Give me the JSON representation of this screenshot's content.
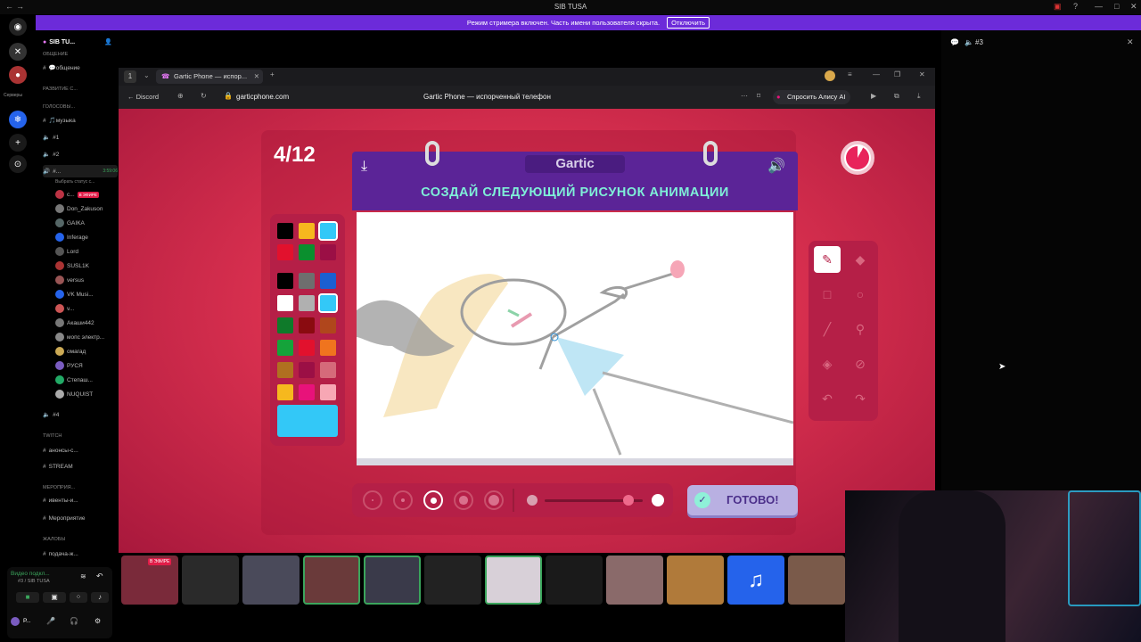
{
  "window": {
    "title": "SIB TUSA"
  },
  "banner": {
    "text": "Режим стримера включен. Часть имени пользователя скрыта.",
    "button": "Отключить"
  },
  "rail": {
    "servers_label": "Серверы"
  },
  "server": {
    "name": "SIB TU..."
  },
  "channels": [
    {
      "type": "cat",
      "label": "ОБЩЕНИЕ"
    },
    {
      "type": "text",
      "label": "💬общение"
    },
    {
      "type": "cat",
      "label": "РАЗВИТИЕ С..."
    },
    {
      "type": "cat",
      "label": "ГОЛОСОВЫ..."
    },
    {
      "type": "text",
      "label": "🎵музыка"
    },
    {
      "type": "voice",
      "label": "#1"
    },
    {
      "type": "voice",
      "label": "#2"
    },
    {
      "type": "voice",
      "label": "#...",
      "active": true,
      "time": "3:59:06"
    },
    {
      "type": "status",
      "label": "Выбрать статус с..."
    }
  ],
  "members": [
    {
      "name": "с...",
      "badge": "В ЭФИРЕ"
    },
    {
      "name": "Don_Zakuson"
    },
    {
      "name": "GAIKA"
    },
    {
      "name": "Inferage"
    },
    {
      "name": "Lord"
    },
    {
      "name": "SUSL1K"
    },
    {
      "name": "versus"
    },
    {
      "name": "VK Musi..."
    },
    {
      "name": "v..."
    },
    {
      "name": "Акаши442"
    },
    {
      "name": "мопс электр..."
    },
    {
      "name": "омагад"
    },
    {
      "name": "РУСЯ"
    },
    {
      "name": "Степаш..."
    },
    {
      "name": "NUQUIST"
    }
  ],
  "channels2": [
    {
      "type": "voice",
      "label": "#4"
    },
    {
      "type": "cat",
      "label": "TWITCH"
    },
    {
      "type": "text",
      "label": "анонсы-с..."
    },
    {
      "type": "text",
      "label": "STREAM"
    },
    {
      "type": "cat",
      "label": "МЕРОПРИЯ..."
    },
    {
      "type": "text",
      "label": "ивенты-и..."
    },
    {
      "type": "text",
      "label": "Мероприятие"
    },
    {
      "type": "cat",
      "label": "ЖАЛОБЫ"
    },
    {
      "type": "text",
      "label": "подача-ж..."
    }
  ],
  "userpanel": {
    "status": "Видео подкл...",
    "sub": "#3 / SIB TUSA",
    "user": "Р..."
  },
  "rpanel": {
    "title": "#3"
  },
  "browser": {
    "tab_title": "Gartic Phone — испор...",
    "back_label": "Discord",
    "url": "garticphone.com",
    "page_title": "Gartic Phone — испорченный телефон",
    "alice_label": "Спросить Алису AI"
  },
  "game": {
    "round": "4/12",
    "logo": "Gartic",
    "instruction": "СОЗДАЙ СЛЕДУЮЩИЙ РИСУНОК АНИМАЦИИ",
    "done_button": "ГОТОВО!",
    "palette_top": [
      "#000000",
      "#f6b81e",
      "#33c8f7",
      "#e2112d",
      "#0a8f2e",
      "#9b0f45"
    ],
    "palette": [
      "#000000",
      "#6e6e6e",
      "#1a5fd1",
      "#ffffff",
      "#b0b0b0",
      "#33c8f7",
      "#0f7a2a",
      "#8a0b10",
      "#b0461c",
      "#15a33a",
      "#e2112d",
      "#f0741e",
      "#b07020",
      "#9b0f45",
      "#d56a7a",
      "#f6b81e",
      "#e8127a",
      "#f7a7b4"
    ],
    "current_color": "#33c8f7",
    "tools": [
      "pen-icon",
      "eraser-icon",
      "rectangle-icon",
      "ellipse-icon",
      "line-icon",
      "eyedropper-icon",
      "fill-icon",
      "clear-icon",
      "undo-icon",
      "redo-icon"
    ],
    "brush_sizes": 5,
    "opacity_level": 0.85
  },
  "stream_thumbs": {
    "live_badge": "В ЭФИРЕ"
  }
}
